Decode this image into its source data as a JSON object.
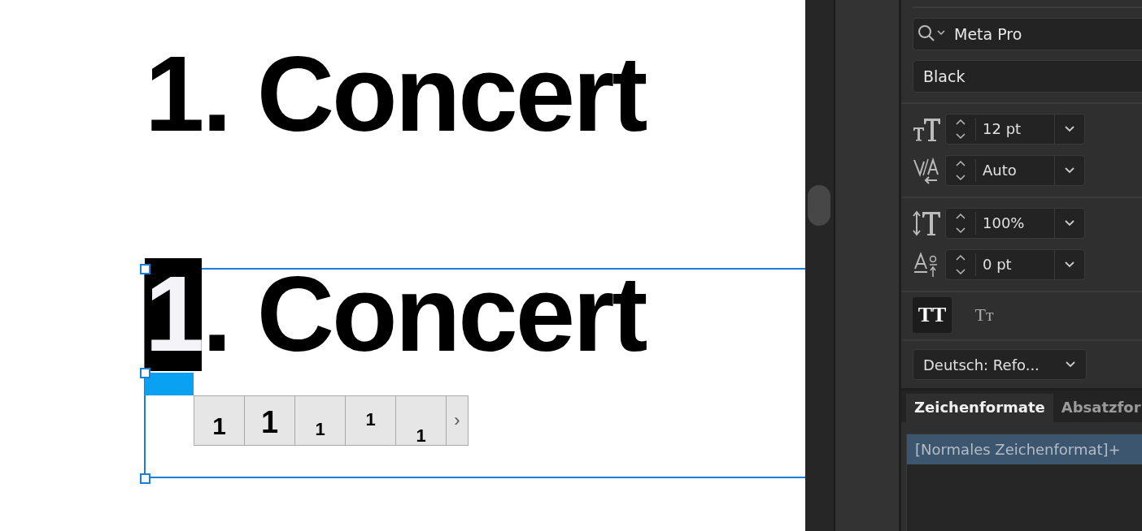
{
  "canvas": {
    "heading": "1. Concert",
    "selected_heading": [
      {
        "text": "1",
        "selected": true
      },
      {
        "text": ". Concert",
        "selected": false
      }
    ],
    "glyph_alternates": [
      {
        "text": "1",
        "kind": "normal"
      },
      {
        "text": "1",
        "kind": "tall"
      },
      {
        "text": "1",
        "kind": "small"
      },
      {
        "text": "1",
        "kind": "superscript"
      },
      {
        "text": "1",
        "kind": "subscript"
      }
    ],
    "more_button": "›"
  },
  "character_panel": {
    "font_family": "Meta Pro",
    "font_style": "Black",
    "spinners": [
      {
        "kind": "size",
        "value": "12 pt"
      },
      {
        "kind": "tracking",
        "value": "Auto"
      },
      {
        "kind": "vscale",
        "value": "100%"
      },
      {
        "kind": "baseline",
        "value": "0 pt"
      }
    ],
    "case_buttons": [
      {
        "kind": "all-caps",
        "text": "TT",
        "selected": true
      },
      {
        "kind": "small-caps",
        "text": "Tт",
        "selected": false
      }
    ],
    "language": "Deutsch: Refo...",
    "tabs": [
      {
        "label": "Zeichenformate",
        "selected": true
      },
      {
        "label": "Absatzfor",
        "selected": false
      }
    ],
    "styles": [
      {
        "label": "[Normales Zeichenformat]+",
        "selected": true
      }
    ]
  }
}
